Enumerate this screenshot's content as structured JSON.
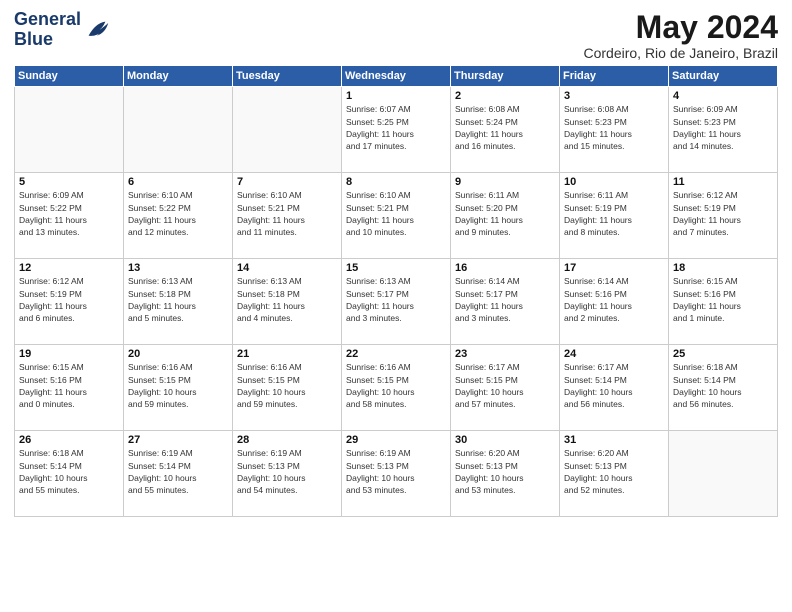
{
  "logo": {
    "line1": "General",
    "line2": "Blue"
  },
  "title": "May 2024",
  "location": "Cordeiro, Rio de Janeiro, Brazil",
  "days_of_week": [
    "Sunday",
    "Monday",
    "Tuesday",
    "Wednesday",
    "Thursday",
    "Friday",
    "Saturday"
  ],
  "weeks": [
    [
      {
        "day": "",
        "info": ""
      },
      {
        "day": "",
        "info": ""
      },
      {
        "day": "",
        "info": ""
      },
      {
        "day": "1",
        "info": "Sunrise: 6:07 AM\nSunset: 5:25 PM\nDaylight: 11 hours\nand 17 minutes."
      },
      {
        "day": "2",
        "info": "Sunrise: 6:08 AM\nSunset: 5:24 PM\nDaylight: 11 hours\nand 16 minutes."
      },
      {
        "day": "3",
        "info": "Sunrise: 6:08 AM\nSunset: 5:23 PM\nDaylight: 11 hours\nand 15 minutes."
      },
      {
        "day": "4",
        "info": "Sunrise: 6:09 AM\nSunset: 5:23 PM\nDaylight: 11 hours\nand 14 minutes."
      }
    ],
    [
      {
        "day": "5",
        "info": "Sunrise: 6:09 AM\nSunset: 5:22 PM\nDaylight: 11 hours\nand 13 minutes."
      },
      {
        "day": "6",
        "info": "Sunrise: 6:10 AM\nSunset: 5:22 PM\nDaylight: 11 hours\nand 12 minutes."
      },
      {
        "day": "7",
        "info": "Sunrise: 6:10 AM\nSunset: 5:21 PM\nDaylight: 11 hours\nand 11 minutes."
      },
      {
        "day": "8",
        "info": "Sunrise: 6:10 AM\nSunset: 5:21 PM\nDaylight: 11 hours\nand 10 minutes."
      },
      {
        "day": "9",
        "info": "Sunrise: 6:11 AM\nSunset: 5:20 PM\nDaylight: 11 hours\nand 9 minutes."
      },
      {
        "day": "10",
        "info": "Sunrise: 6:11 AM\nSunset: 5:19 PM\nDaylight: 11 hours\nand 8 minutes."
      },
      {
        "day": "11",
        "info": "Sunrise: 6:12 AM\nSunset: 5:19 PM\nDaylight: 11 hours\nand 7 minutes."
      }
    ],
    [
      {
        "day": "12",
        "info": "Sunrise: 6:12 AM\nSunset: 5:19 PM\nDaylight: 11 hours\nand 6 minutes."
      },
      {
        "day": "13",
        "info": "Sunrise: 6:13 AM\nSunset: 5:18 PM\nDaylight: 11 hours\nand 5 minutes."
      },
      {
        "day": "14",
        "info": "Sunrise: 6:13 AM\nSunset: 5:18 PM\nDaylight: 11 hours\nand 4 minutes."
      },
      {
        "day": "15",
        "info": "Sunrise: 6:13 AM\nSunset: 5:17 PM\nDaylight: 11 hours\nand 3 minutes."
      },
      {
        "day": "16",
        "info": "Sunrise: 6:14 AM\nSunset: 5:17 PM\nDaylight: 11 hours\nand 3 minutes."
      },
      {
        "day": "17",
        "info": "Sunrise: 6:14 AM\nSunset: 5:16 PM\nDaylight: 11 hours\nand 2 minutes."
      },
      {
        "day": "18",
        "info": "Sunrise: 6:15 AM\nSunset: 5:16 PM\nDaylight: 11 hours\nand 1 minute."
      }
    ],
    [
      {
        "day": "19",
        "info": "Sunrise: 6:15 AM\nSunset: 5:16 PM\nDaylight: 11 hours\nand 0 minutes."
      },
      {
        "day": "20",
        "info": "Sunrise: 6:16 AM\nSunset: 5:15 PM\nDaylight: 10 hours\nand 59 minutes."
      },
      {
        "day": "21",
        "info": "Sunrise: 6:16 AM\nSunset: 5:15 PM\nDaylight: 10 hours\nand 59 minutes."
      },
      {
        "day": "22",
        "info": "Sunrise: 6:16 AM\nSunset: 5:15 PM\nDaylight: 10 hours\nand 58 minutes."
      },
      {
        "day": "23",
        "info": "Sunrise: 6:17 AM\nSunset: 5:15 PM\nDaylight: 10 hours\nand 57 minutes."
      },
      {
        "day": "24",
        "info": "Sunrise: 6:17 AM\nSunset: 5:14 PM\nDaylight: 10 hours\nand 56 minutes."
      },
      {
        "day": "25",
        "info": "Sunrise: 6:18 AM\nSunset: 5:14 PM\nDaylight: 10 hours\nand 56 minutes."
      }
    ],
    [
      {
        "day": "26",
        "info": "Sunrise: 6:18 AM\nSunset: 5:14 PM\nDaylight: 10 hours\nand 55 minutes."
      },
      {
        "day": "27",
        "info": "Sunrise: 6:19 AM\nSunset: 5:14 PM\nDaylight: 10 hours\nand 55 minutes."
      },
      {
        "day": "28",
        "info": "Sunrise: 6:19 AM\nSunset: 5:13 PM\nDaylight: 10 hours\nand 54 minutes."
      },
      {
        "day": "29",
        "info": "Sunrise: 6:19 AM\nSunset: 5:13 PM\nDaylight: 10 hours\nand 53 minutes."
      },
      {
        "day": "30",
        "info": "Sunrise: 6:20 AM\nSunset: 5:13 PM\nDaylight: 10 hours\nand 53 minutes."
      },
      {
        "day": "31",
        "info": "Sunrise: 6:20 AM\nSunset: 5:13 PM\nDaylight: 10 hours\nand 52 minutes."
      },
      {
        "day": "",
        "info": ""
      }
    ]
  ]
}
